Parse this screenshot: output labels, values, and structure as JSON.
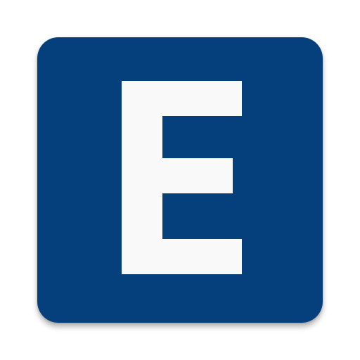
{
  "icon": {
    "letter": "E",
    "name": "e-letter-icon",
    "background_color": "#053f7c",
    "letter_color": "#f9f9f9",
    "page_background": "#ffffff"
  }
}
